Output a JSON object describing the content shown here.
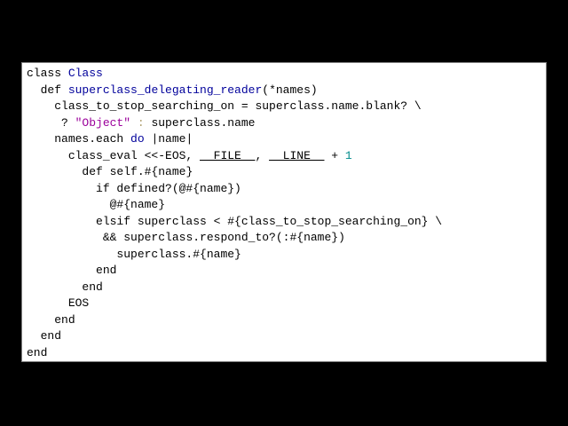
{
  "colors": {
    "background": "#000000",
    "panel": "#ffffff",
    "keyword": "#000000",
    "class_name": "#00009b",
    "method_name": "#00009b",
    "string": "#9b009b",
    "number": "#008b8b",
    "muted": "#b0a070"
  },
  "code": {
    "l1_kw": "class",
    "l1_name": "Class",
    "l2_kw": "def",
    "l2_fn": "superclass_delegating_reader",
    "l2_args": "(*names)",
    "l3_text": "class_to_stop_searching_on = superclass.name.blank? \\",
    "l4_q": "? ",
    "l4_str": "\"Object\"",
    "l4_colon": " : ",
    "l4_rest": "superclass.name",
    "l5_pre": "names.each ",
    "l5_do": "do",
    "l5_post": " |name|",
    "l6_pre": "class_eval <<-EOS, ",
    "l6_file": "__FILE__",
    "l6_comma": ", ",
    "l6_line": "__LINE__",
    "l6_plus": " + ",
    "l6_num": "1",
    "l7_text": "def self.#{name}",
    "l8_text": "if defined?(@#{name})",
    "l9_text": "@#{name}",
    "l10_text": "elsif superclass < #{class_to_stop_searching_on} \\",
    "l11_text": "&& superclass.respond_to?(:#{name})",
    "l12_text": "superclass.#{name}",
    "l13_text": "end",
    "l14_text": "end",
    "l15_text": "EOS",
    "l16_text": "end",
    "l17_text": "end",
    "l18_text": "end"
  }
}
